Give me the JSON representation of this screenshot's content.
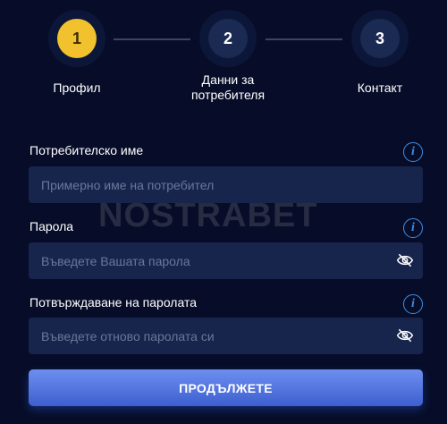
{
  "stepper": {
    "steps": [
      {
        "number": "1",
        "label": "Профил",
        "state": "active"
      },
      {
        "number": "2",
        "label_line1": "Данни за",
        "label_line2": "потребителя",
        "state": "inactive"
      },
      {
        "number": "3",
        "label": "Контакт",
        "state": "inactive"
      }
    ]
  },
  "form": {
    "username": {
      "label": "Потребителско име",
      "placeholder": "Примерно име на потребител",
      "info_icon": "info-icon"
    },
    "password": {
      "label": "Парола",
      "placeholder": "Въведете Вашата парола",
      "info_icon": "info-icon",
      "toggle_icon": "eye-off-icon"
    },
    "confirm_password": {
      "label": "Потвърждаване на паролата",
      "placeholder": "Въведете отново паролата си",
      "info_icon": "info-icon",
      "toggle_icon": "eye-off-icon"
    },
    "submit_label": "ПРОДЪЛЖЕТЕ"
  },
  "watermark": "NOSTRABET",
  "colors": {
    "background": "#070d28",
    "active_step": "#f2c12e",
    "input_bg": "#17254d",
    "accent": "#3f8ee6",
    "button": "#4d6fdc"
  }
}
